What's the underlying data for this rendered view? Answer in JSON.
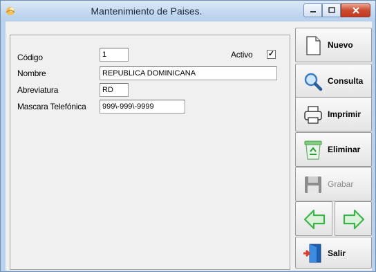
{
  "window": {
    "title": "Mantenimiento de Paises."
  },
  "form": {
    "codigo_label": "Código",
    "codigo_value": "1",
    "activo_label": "Activo",
    "activo_checked": true,
    "nombre_label": "Nombre",
    "nombre_value": "REPUBLICA DOMINICANA",
    "abreviatura_label": "Abreviatura",
    "abreviatura_value": "RD",
    "mascara_label": "Mascara Telefónica",
    "mascara_value": "999\\-999\\-9999"
  },
  "buttons": {
    "nuevo": "Nuevo",
    "consulta": "Consulta",
    "imprimir": "Imprimir",
    "eliminar": "Eliminar",
    "grabar": "Grabar",
    "salir": "Salir"
  },
  "colors": {
    "nav_arrow": "#3cb34a",
    "close_button": "#c23b22"
  }
}
